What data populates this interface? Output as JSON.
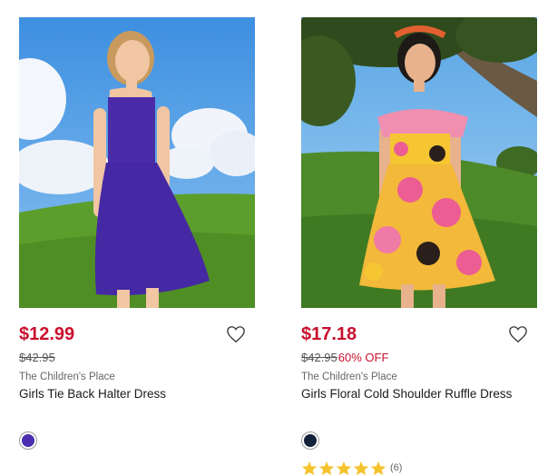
{
  "products": [
    {
      "sale_price": "$12.99",
      "original_price": "$42.95",
      "discount": "",
      "brand": "The Children's Place",
      "name": "Girls Tie Back Halter Dress",
      "swatch_color": "#4b2fb0"
    },
    {
      "sale_price": "$17.18",
      "original_price": "$42.95",
      "discount": "60% OFF",
      "brand": "The Children's Place",
      "name": "Girls Floral Cold Shoulder Ruffle Dress",
      "swatch_color": "#13223b",
      "rating": {
        "stars": 5,
        "count": "(6)"
      }
    }
  ],
  "colors": {
    "accent": "#c8102e",
    "star": "#f5c32c"
  }
}
